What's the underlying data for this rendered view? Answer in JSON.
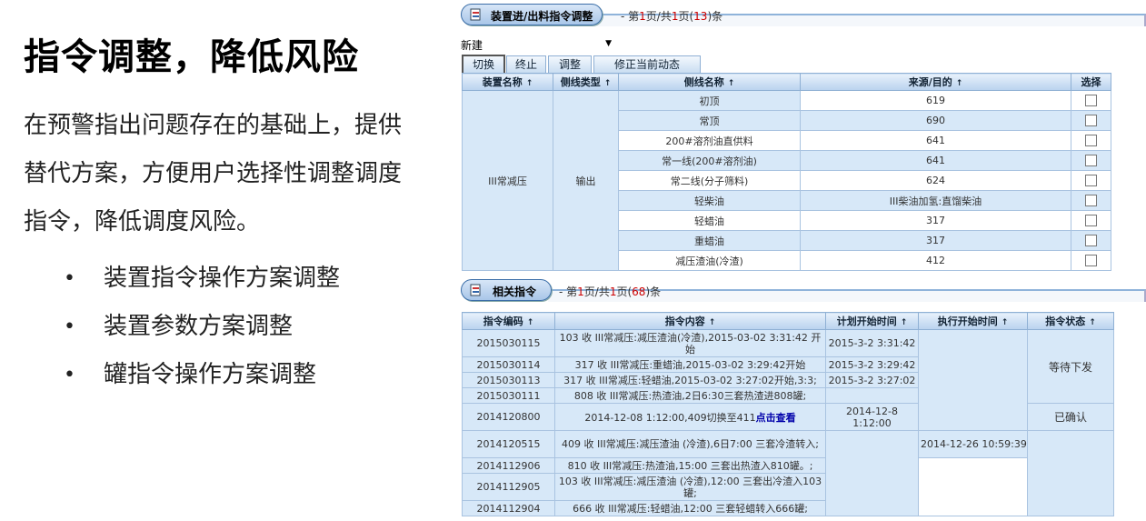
{
  "slide": {
    "title": "指令调整，降低风险",
    "body": "在预警指出问题存在的基础上，提供替代方案，方便用户选择性调整调度指令，降低调度风险。",
    "bullet_symbol": "•",
    "bullets": [
      "装置指令操作方案调整",
      "装置参数方案调整",
      "罐指令操作方案调整"
    ]
  },
  "panel1": {
    "title": "装置进/出料指令调整",
    "page_prefix": "- 第",
    "page_current": "1",
    "page_mid": "页/共",
    "page_total": "1",
    "page_mid2": "页(",
    "count": "13",
    "page_suffix": ")条",
    "dropdown": "新建",
    "buttons": [
      "切换",
      "终止",
      "调整",
      "修正当前动态"
    ],
    "sort_symbol": "↑",
    "columns": [
      "装置名称",
      "侧线类型",
      "侧线名称",
      "来源/目的",
      "选择"
    ],
    "unit": "III常减压",
    "line_type": "输出",
    "rows": [
      {
        "name": "初顶",
        "target": "619"
      },
      {
        "name": "常顶",
        "target": "690"
      },
      {
        "name": "200#溶剂油直供料",
        "target": "641"
      },
      {
        "name": "常一线(200#溶剂油)",
        "target": "641"
      },
      {
        "name": "常二线(分子筛料)",
        "target": "624"
      },
      {
        "name": "轻柴油",
        "target": "III柴油加氢:直馏柴油"
      },
      {
        "name": "轻蜡油",
        "target": "317"
      },
      {
        "name": "重蜡油",
        "target": "317"
      },
      {
        "name": "减压渣油(冷渣)",
        "target": "412"
      }
    ]
  },
  "panel2": {
    "title": "相关指令",
    "page_prefix": "- 第",
    "page_current": "1",
    "page_mid": "页/共",
    "page_total": "1",
    "page_mid2": "页(",
    "count": "68",
    "page_suffix": ")条",
    "sort_symbol": "↑",
    "columns": [
      "指令编码",
      "指令内容",
      "计划开始时间",
      "执行开始时间",
      "指令状态"
    ],
    "rows": [
      {
        "code": "2015030115",
        "content": "103 收 III常减压:减压渣油(冷渣),2015-03-02 3:31:42 开始",
        "plan": "2015-3-2 3:31:42"
      },
      {
        "code": "2015030114",
        "content": "317 收 III常减压:重蜡油,2015-03-02 3:29:42开始",
        "plan": "2015-3-2 3:29:42"
      },
      {
        "code": "2015030113",
        "content": "317 收 III常减压:轻蜡油,2015-03-02 3:27:02开始,3:3;",
        "plan": "2015-3-2 3:27:02"
      },
      {
        "code": "2015030111",
        "content": "808 收 III常减压:热渣油,2日6:30三套热渣进808罐;",
        "plan": ""
      },
      {
        "code": "2014120800",
        "content": "2014-12-08 1:12:00,409切换至411",
        "link": "点击查看",
        "plan": "2014-12-8 1:12:00"
      },
      {
        "code": "2014120515",
        "content": "409 收 III常减压:减压渣油 (冷渣),6日7:00 三套冷渣转入;",
        "plan": ""
      },
      {
        "code": "2014112906",
        "content": "810 收 III常减压:热渣油,15:00 三套出热渣入810罐。;",
        "plan": ""
      },
      {
        "code": "2014112905",
        "content": "103 收 III常减压:减压渣油 (冷渣),12:00 三套出冷渣入103罐;",
        "plan": ""
      },
      {
        "code": "2014112904",
        "content": "666 收 III常减压:轻蜡油,12:00 三套轻蜡转入666罐;",
        "plan": ""
      }
    ],
    "exec_time": "2014-12-26 10:59:39",
    "status_pending": "等待下发",
    "status_confirmed": "已确认"
  }
}
